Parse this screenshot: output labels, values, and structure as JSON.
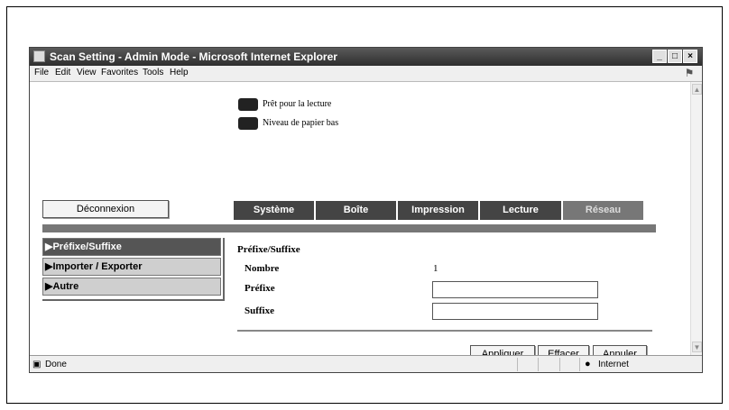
{
  "window": {
    "title": "Scan Setting - Admin Mode - Microsoft Internet Explorer",
    "min_glyph": "_",
    "max_glyph": "□",
    "close_glyph": "×"
  },
  "menu": [
    "File",
    "Edit",
    "View",
    "Favorites",
    "Tools",
    "Help"
  ],
  "device_status": [
    "Prêt pour la lecture",
    "Niveau de papier bas"
  ],
  "logout_label": "Déconnexion",
  "tabs": [
    {
      "label": "Système"
    },
    {
      "label": "Boîte"
    },
    {
      "label": "Impression"
    },
    {
      "label": "Lecture"
    },
    {
      "label": "Réseau"
    }
  ],
  "sidebar": [
    {
      "label": "▶Préfixe/Suffixe"
    },
    {
      "label": "▶Importer / Exporter"
    },
    {
      "label": "▶Autre"
    }
  ],
  "form": {
    "title": "Préfixe/Suffixe",
    "number_label": "Nombre",
    "number_value": "1",
    "prefix_label": "Préfixe",
    "prefix_value": "",
    "suffix_label": "Suffixe",
    "suffix_value": ""
  },
  "buttons": {
    "apply": "Appliquer",
    "clear": "Effacer",
    "cancel": "Annuler"
  },
  "status": {
    "text": "Done",
    "zone": "Internet"
  }
}
